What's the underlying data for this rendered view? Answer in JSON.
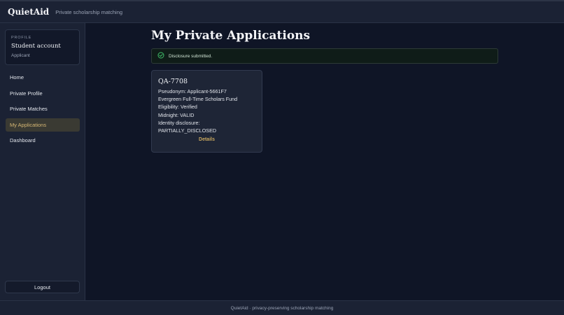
{
  "app": {
    "brand": "QuietAid",
    "tagline": "Private scholarship matching"
  },
  "profile": {
    "kicker": "PROFILE",
    "name": "Student account",
    "role": "Applicant"
  },
  "nav": {
    "items": [
      {
        "label": "Home"
      },
      {
        "label": "Private Profile"
      },
      {
        "label": "Private Matches"
      },
      {
        "label": "My Applications",
        "active": true
      },
      {
        "label": "Dashboard"
      }
    ]
  },
  "logout_label": "Logout",
  "page": {
    "title": "My Private Applications"
  },
  "alert": {
    "text": "Disclosure submitted.",
    "icon": "check-circle-icon",
    "color": "#3fbf6a"
  },
  "application": {
    "id": "QA-7708",
    "pseudonym": "Pseudonym: Applicant-5661F7",
    "fund": "Evergreen Full-Time Scholars Fund",
    "eligibility": "Eligibility: Verified",
    "midnight": "Midnight: VALID",
    "disclosure_label": "Identity disclosure:",
    "disclosure_value": "PARTIALLY_DISCLOSED",
    "details_label": "Details"
  },
  "footer": {
    "text": "QuietAid · privacy-preserving scholarship matching"
  },
  "colors": {
    "accent": "#c9a85f",
    "background": "#0f1526",
    "surface": "#1b2234"
  }
}
